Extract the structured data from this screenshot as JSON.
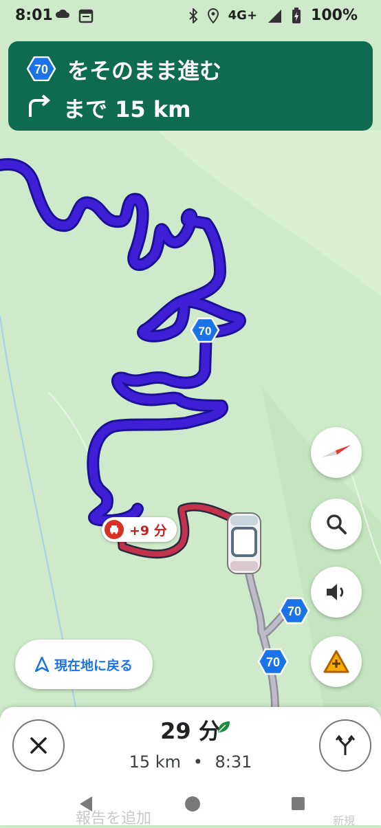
{
  "status_bar": {
    "time": "8:01",
    "network": "4G+",
    "battery": "100%"
  },
  "navigation": {
    "route_number": "70",
    "instruction": "をそのまま進む",
    "distance_text": "まで 15 km"
  },
  "map": {
    "route_shields": [
      "70",
      "70",
      "70"
    ],
    "delay_label": "+9 分",
    "recenter_label": "現在地に戻る"
  },
  "trip": {
    "duration": "29 分",
    "distance": "15 km",
    "separator": "•",
    "arrival": "8:31"
  },
  "behind_sheet": {
    "report_label": "報告を追加",
    "new_label": "新規"
  },
  "colors": {
    "nav_banner": "#0f6b4f",
    "route": "#3f1fd6",
    "route_outline": "#1c1096",
    "delay_segment": "#c2324f",
    "traveled": "#a8a8b4",
    "map_bg": "#cfeacb",
    "accent": "#1a73e8"
  }
}
